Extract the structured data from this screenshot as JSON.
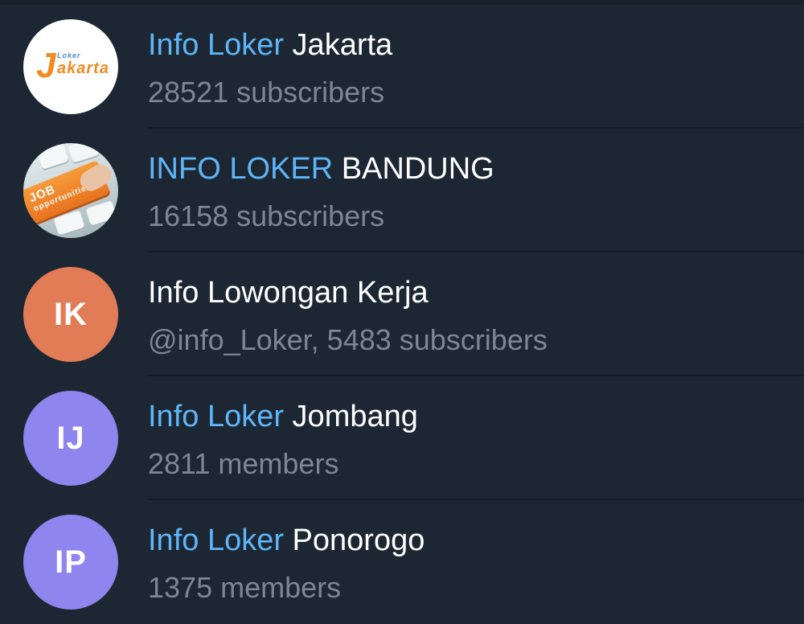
{
  "results": [
    {
      "title_highlight": "Info Loker",
      "title_rest": " Jakarta",
      "subtitle": "28521 subscribers",
      "avatar": {
        "type": "logo",
        "icon": "loker-jakarta-logo",
        "logo_small": "Loker",
        "logo_letter": "J",
        "logo_word": "akarta",
        "colors": {
          "primary": "#f28b22",
          "secondary": "#4a8bc9"
        }
      }
    },
    {
      "title_highlight": "INFO LOKER",
      "title_rest": " BANDUNG",
      "subtitle": "16158 subscribers",
      "avatar": {
        "type": "photo",
        "icon": "job-opportunities-keyboard-photo",
        "photo_text_1": "JOB",
        "photo_text_2": "opportunities"
      }
    },
    {
      "title_highlight": "",
      "title_rest": "Info Lowongan Kerja",
      "subtitle": "@info_Loker, 5483 subscribers",
      "avatar": {
        "type": "initials",
        "initials": "IK",
        "color": "#e17c56"
      }
    },
    {
      "title_highlight": "Info Loker",
      "title_rest": " Jombang",
      "subtitle": "2811 members",
      "avatar": {
        "type": "initials",
        "initials": "IJ",
        "color": "#8e85ee"
      }
    },
    {
      "title_highlight": "Info Loker",
      "title_rest": " Ponorogo",
      "subtitle": "1375 members",
      "avatar": {
        "type": "initials",
        "initials": "IP",
        "color": "#8e85ee"
      }
    }
  ],
  "colors": {
    "background": "#1d2733",
    "highlight": "#5eb5f7",
    "title": "#ffffff",
    "subtitle": "#7b8796",
    "divider": "#141c25"
  }
}
